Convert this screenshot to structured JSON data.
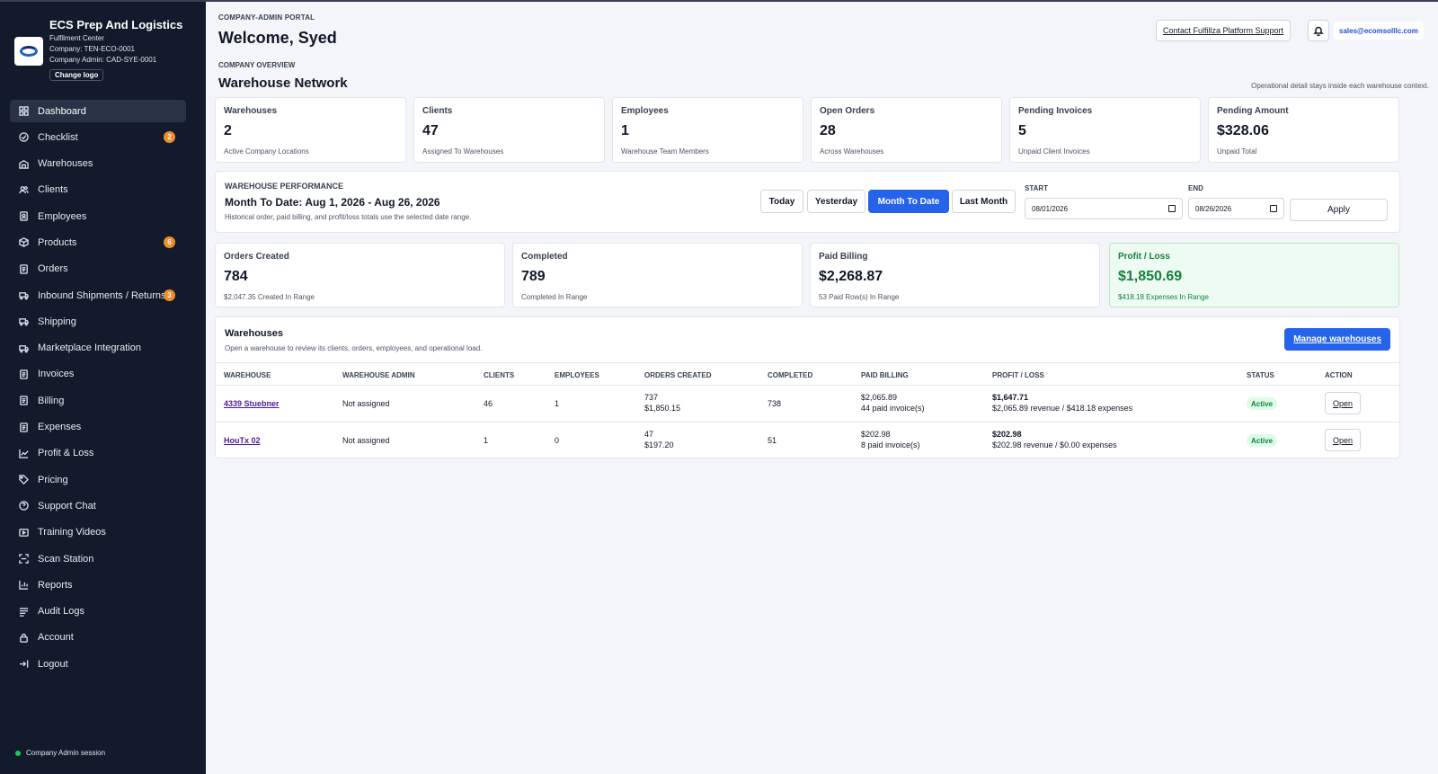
{
  "brand": {
    "name": "ECS Prep And Logistics",
    "subtitle": "Fulfilment Center",
    "company": "Company: TEN-ECO-0001",
    "admin": "Company Admin: CAD-SYE-0001",
    "change_logo": "Change logo"
  },
  "sidebar": {
    "items": [
      {
        "label": "Dashboard",
        "icon": "grid-icon",
        "active": true
      },
      {
        "label": "Checklist",
        "icon": "check-circle-icon",
        "badge": "2"
      },
      {
        "label": "Warehouses",
        "icon": "warehouse-icon"
      },
      {
        "label": "Clients",
        "icon": "users-icon"
      },
      {
        "label": "Employees",
        "icon": "id-badge-icon"
      },
      {
        "label": "Products",
        "icon": "box-icon",
        "badge": "6"
      },
      {
        "label": "Orders",
        "icon": "document-icon"
      },
      {
        "label": "Inbound Shipments / Returns",
        "icon": "truck-icon",
        "badge": "3"
      },
      {
        "label": "Shipping",
        "icon": "truck-icon"
      },
      {
        "label": "Marketplace Integration",
        "icon": "truck-icon"
      },
      {
        "label": "Invoices",
        "icon": "document-icon"
      },
      {
        "label": "Billing",
        "icon": "document-icon"
      },
      {
        "label": "Expenses",
        "icon": "document-icon"
      },
      {
        "label": "Profit & Loss",
        "icon": "line-chart-icon"
      },
      {
        "label": "Pricing",
        "icon": "tag-icon"
      },
      {
        "label": "Support Chat",
        "icon": "help-circle-icon"
      },
      {
        "label": "Training Videos",
        "icon": "video-icon"
      },
      {
        "label": "Scan Station",
        "icon": "scan-icon"
      },
      {
        "label": "Reports",
        "icon": "bar-chart-icon"
      },
      {
        "label": "Audit Logs",
        "icon": "list-icon"
      },
      {
        "label": "Account",
        "icon": "lock-icon"
      },
      {
        "label": "Logout",
        "icon": "logout-icon"
      }
    ],
    "session": "Company Admin session"
  },
  "header": {
    "portal_label": "COMPANY-ADMIN PORTAL",
    "welcome": "Welcome, Syed",
    "support_button": "Contact Fulfillza Platform Support",
    "email": "sales@ecomsolllc.com",
    "overview_label": "COMPANY OVERVIEW",
    "network_title": "Warehouse Network",
    "note": "Operational detail stays inside each warehouse context."
  },
  "stats": [
    {
      "label": "Warehouses",
      "value": "2",
      "sub": "Active Company Locations"
    },
    {
      "label": "Clients",
      "value": "47",
      "sub": "Assigned To Warehouses"
    },
    {
      "label": "Employees",
      "value": "1",
      "sub": "Warehouse Team Members"
    },
    {
      "label": "Open Orders",
      "value": "28",
      "sub": "Across Warehouses"
    },
    {
      "label": "Pending Invoices",
      "value": "5",
      "sub": "Unpaid Client Invoices"
    },
    {
      "label": "Pending Amount",
      "value": "$328.06",
      "sub": "Unpaid Total"
    }
  ],
  "performance": {
    "label": "WAREHOUSE PERFORMANCE",
    "title": "Month To Date: Aug 1, 2026 - Aug 26, 2026",
    "note": "Historical order, paid billing, and profit/loss totals use the selected date range.",
    "ranges": [
      "Today",
      "Yesterday",
      "Month To Date",
      "Last Month"
    ],
    "active_range": "Month To Date",
    "start_label": "START",
    "start_value": "08/01/2026",
    "end_label": "END",
    "end_value": "08/26/2026",
    "apply": "Apply"
  },
  "range_stats": [
    {
      "label": "Orders Created",
      "value": "784",
      "sub": "$2,047.35 Created In Range"
    },
    {
      "label": "Completed",
      "value": "789",
      "sub": "Completed In Range"
    },
    {
      "label": "Paid Billing",
      "value": "$2,268.87",
      "sub": "53 Paid Row(s) In Range"
    },
    {
      "label": "Profit / Loss",
      "value": "$1,850.69",
      "sub": "$418.18 Expenses In Range"
    }
  ],
  "warehouses": {
    "title": "Warehouses",
    "note": "Open a warehouse to review its clients, orders, employees, and operational load.",
    "manage_button": "Manage warehouses",
    "columns": [
      "WAREHOUSE",
      "WAREHOUSE ADMIN",
      "CLIENTS",
      "EMPLOYEES",
      "ORDERS CREATED",
      "COMPLETED",
      "PAID BILLING",
      "PROFIT / LOSS",
      "STATUS",
      "ACTION"
    ],
    "rows": [
      {
        "name": "4339 Stuebner",
        "admin": "Not assigned",
        "clients": "46",
        "employees": "1",
        "orders_count": "737",
        "orders_amount": "$1,850.15",
        "completed": "738",
        "paid_amount": "$2,065.89",
        "paid_count": "44 paid invoice(s)",
        "profit": "$1,647.71",
        "profit_detail": "$2,065.89 revenue / $418.18 expenses",
        "status": "Active",
        "action": "Open"
      },
      {
        "name": "HouTx 02",
        "admin": "Not assigned",
        "clients": "1",
        "employees": "0",
        "orders_count": "47",
        "orders_amount": "$197.20",
        "completed": "51",
        "paid_amount": "$202.98",
        "paid_count": "8 paid invoice(s)",
        "profit": "$202.98",
        "profit_detail": "$202.98 revenue / $0.00 expenses",
        "status": "Active",
        "action": "Open"
      }
    ]
  },
  "colors": {
    "sidebar_bg": "#121a2b",
    "accent": "#2563eb",
    "badge": "#f28c28",
    "profit_green": "#15803d"
  }
}
